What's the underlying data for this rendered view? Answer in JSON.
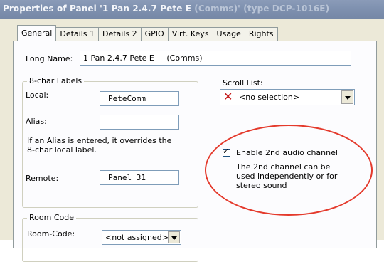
{
  "window": {
    "title": "Properties of Panel '1 Pan 2.4.7 Pete E",
    "title_faded": "    (Comms)' (type DCP-1016E)"
  },
  "tabs": [
    {
      "label": "General",
      "active": true
    },
    {
      "label": "Details 1",
      "active": false
    },
    {
      "label": "Details 2",
      "active": false
    },
    {
      "label": "GPIO",
      "active": false
    },
    {
      "label": "Virt. Keys",
      "active": false
    },
    {
      "label": "Usage",
      "active": false
    },
    {
      "label": "Rights",
      "active": false
    }
  ],
  "long_name": {
    "label": "Long Name:",
    "value": "1 Pan 2.4.7 Pete E     (Comms)"
  },
  "labels_group": {
    "title": "8-char Labels",
    "local_label": "Local:",
    "local_value": "PeteComm",
    "alias_label": "Alias:",
    "alias_value": "",
    "alias_note_line1": "If an Alias is entered, it overrides the",
    "alias_note_line2": "8-char local label.",
    "remote_label": "Remote:",
    "remote_value": "Panel 31"
  },
  "scroll_list": {
    "label": "Scroll List:",
    "value": "<no selection>",
    "icon": "x-icon"
  },
  "audio": {
    "checkbox_label": "Enable 2nd audio channel",
    "checked": true,
    "desc_line1": "The 2nd channel can be",
    "desc_line2": "used independently or for",
    "desc_line3": "stereo sound"
  },
  "room_group": {
    "title": "Room Code",
    "room_code_label": "Room-Code:",
    "room_code_value": "<not assigned>"
  },
  "colors": {
    "highlight_ellipse": "#e43a2c",
    "titlebar": "#7d8fae",
    "dialog_bg": "#ece9d8"
  }
}
